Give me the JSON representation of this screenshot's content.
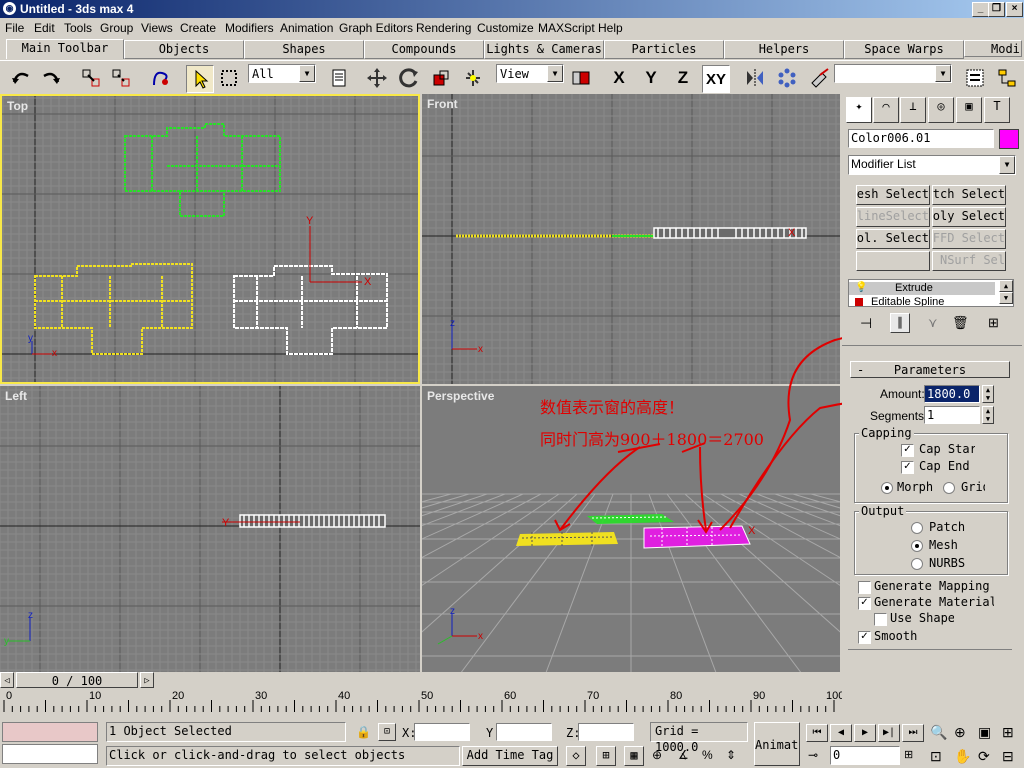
{
  "window": {
    "title": "Untitled - 3ds max 4",
    "app_icon": "3ds-max-icon"
  },
  "menu": [
    "File",
    "Edit",
    "Tools",
    "Group",
    "Views",
    "Create",
    "Modifiers",
    "Animation",
    "Graph Editors",
    "Rendering",
    "Customize",
    "MAXScript",
    "Help"
  ],
  "tabs": [
    "Main Toolbar",
    "Objects",
    "Shapes",
    "Compounds",
    "Lights & Cameras",
    "Particles",
    "Helpers",
    "Space Warps",
    "Modi"
  ],
  "toolbar": {
    "selection_filter": "All",
    "reference_coord": "View",
    "axis_x": "X",
    "axis_y": "Y",
    "axis_z": "Z",
    "axis_xy": "XY"
  },
  "viewports": {
    "top": "Top",
    "front": "Front",
    "left": "Left",
    "perspective": "Perspective"
  },
  "annotation": {
    "line1": "数值表示窗的高度！",
    "line2": "同时门高为900＋1800＝2700"
  },
  "command_panel": {
    "object_name": "Color006.01",
    "object_color": "#ff00ff",
    "modifier_list": "Modifier List",
    "mod_buttons": [
      "Mesh Select",
      "Patch Select",
      "SplineSelect",
      "Poly Select",
      "Vol. Select",
      "FFD Select",
      "",
      "NSurf Sel"
    ],
    "stack": [
      "Extrude",
      "Editable Spline"
    ],
    "rollout_title": "Parameters",
    "amount_label": "Amount:",
    "amount_value": "1800.0",
    "segments_label": "Segments:",
    "segments_value": "1",
    "capping_title": "Capping",
    "cap_start": "Cap Start",
    "cap_end": "Cap End",
    "morph": "Morph",
    "grid": "Grid",
    "output_title": "Output",
    "patch": "Patch",
    "mesh": "Mesh",
    "nurbs": "NURBS",
    "gen_mapping": "Generate Mapping Coords.",
    "gen_material": "Generate Material IDs",
    "use_shape": "Use Shape IDs",
    "smooth": "Smooth"
  },
  "timeline": {
    "slider": "0 / 100",
    "ticks": [
      "0",
      "10",
      "20",
      "30",
      "40",
      "50",
      "60",
      "70",
      "80",
      "90",
      "100"
    ]
  },
  "status": {
    "selected": "1 Object Selected",
    "prompt": "Click or click-and-drag to select objects",
    "x_label": "X:",
    "y_label": "Y:",
    "z_label": "Z:",
    "grid": "Grid = 1000.0",
    "add_time_tag": "Add Time Tag",
    "animate": "Animate",
    "frame": "0"
  }
}
